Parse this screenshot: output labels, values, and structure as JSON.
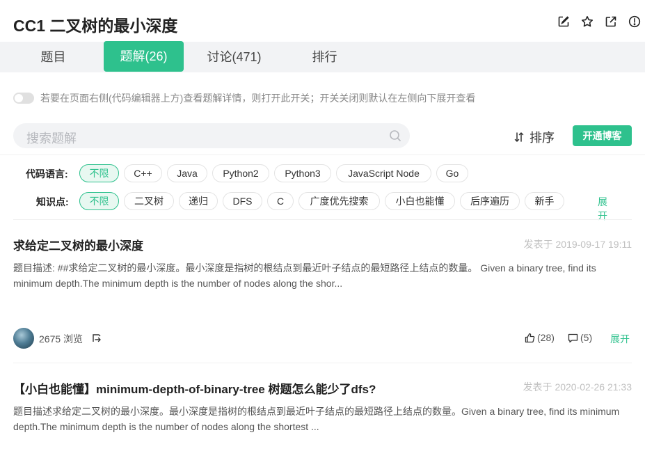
{
  "header": {
    "title": "CC1  二叉树的最小深度",
    "icons": [
      "edit-icon",
      "star-icon",
      "external-link-icon",
      "alert-icon"
    ]
  },
  "tabs": [
    {
      "label": "题目",
      "active": false
    },
    {
      "label": "题解(26)",
      "active": true
    },
    {
      "label": "讨论(471)",
      "active": false
    },
    {
      "label": "排行",
      "active": false
    }
  ],
  "toggle": {
    "label": "若要在页面右侧(代码编辑器上方)查看题解详情，则打开此开关；开关关闭则默认在左侧向下展开查看",
    "on": false
  },
  "search": {
    "placeholder": "搜索题解"
  },
  "sort_label": "排序",
  "blog_button": "开通博客",
  "filters": {
    "language": {
      "label": "代码语言:",
      "options": [
        "不限",
        "C++",
        "Java",
        "Python2",
        "Python3",
        "JavaScript Node",
        "Go"
      ],
      "selected": "不限"
    },
    "knowledge": {
      "label": "知识点:",
      "options": [
        "不限",
        "二叉树",
        "递归",
        "DFS",
        "C",
        "广度优先搜索",
        "小白也能懂",
        "后序遍历",
        "新手"
      ],
      "selected": "不限",
      "expand": "展开"
    }
  },
  "posts": [
    {
      "title": "求给定二叉树的最小深度",
      "date": "发表于 2019-09-17 19:11",
      "desc": "题目描述: ##求给定二叉树的最小深度。最小深度是指树的根结点到最近叶子结点的最短路径上结点的数量。 Given a binary tree, find its minimum depth.The minimum depth is the number of nodes along the shor...",
      "views": "2675 浏览",
      "likes": "(28)",
      "comments": "(5)",
      "expand": "展开"
    },
    {
      "title": "【小白也能懂】minimum-depth-of-binary-tree 树题怎么能少了dfs?",
      "date": "发表于 2020-02-26 21:33",
      "desc": "题目描述求给定二叉树的最小深度。最小深度是指树的根结点到最近叶子结点的最短路径上结点的数量。Given a binary tree, find its minimum depth.The minimum depth is the number of nodes along the shortest ..."
    }
  ],
  "colors": {
    "accent": "#2ec18d",
    "tabbar_bg": "#f2f3f5",
    "chip_active_bg": "#e8f8f1"
  }
}
